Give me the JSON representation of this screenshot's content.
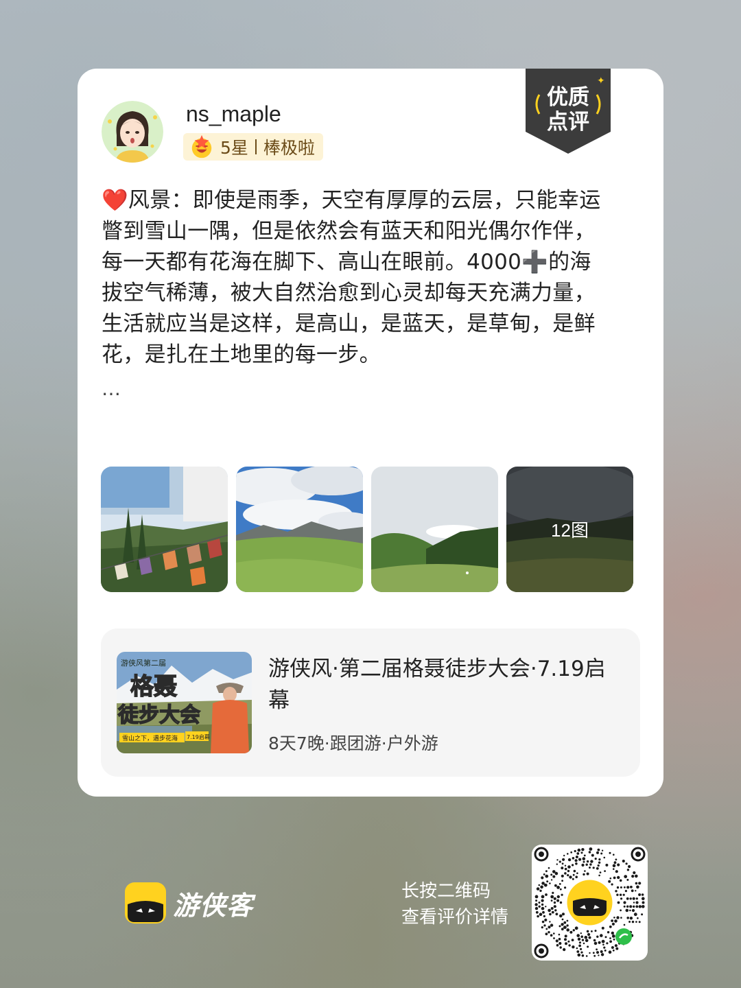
{
  "badge": {
    "line1": "优质",
    "line2": "点评"
  },
  "user": {
    "name": "ns_maple"
  },
  "rating": {
    "stars": "5星",
    "label": "棒极啦"
  },
  "review": {
    "lines": [
      "❤️风景：即使是雨季，天空有厚厚的云层，只能幸运",
      "瞥到雪山一隅，但是依然会有蓝天和阳光偶尔作伴，",
      "每一天都有花海在脚下、高山在眼前。4000➕的海",
      "拔空气稀薄，被大自然治愈到心灵却每天充满力量，",
      "生活就应当是这样，是高山，是蓝天，是草甸，是鲜",
      "花，是扎在土地里的每一步。"
    ],
    "more": "…"
  },
  "photos": {
    "count_label": "12图"
  },
  "product": {
    "title": "游侠风·第二届格聂徒步大会·7.19启幕",
    "meta": "8天7晚·跟团游·户外游",
    "thumb_text": {
      "top": "游侠风第二届",
      "main1": "格聂",
      "main2": "徒步大会",
      "caption": "雪山之下，遇步花海",
      "date": "7.19启幕"
    }
  },
  "footer": {
    "brand": "游侠客",
    "hint_line1": "长按二维码",
    "hint_line2": "查看评价详情"
  },
  "colors": {
    "brand_yellow": "#ffd21f",
    "badge_dark": "#3c3c3c",
    "rating_bg": "#fdf3d6"
  }
}
